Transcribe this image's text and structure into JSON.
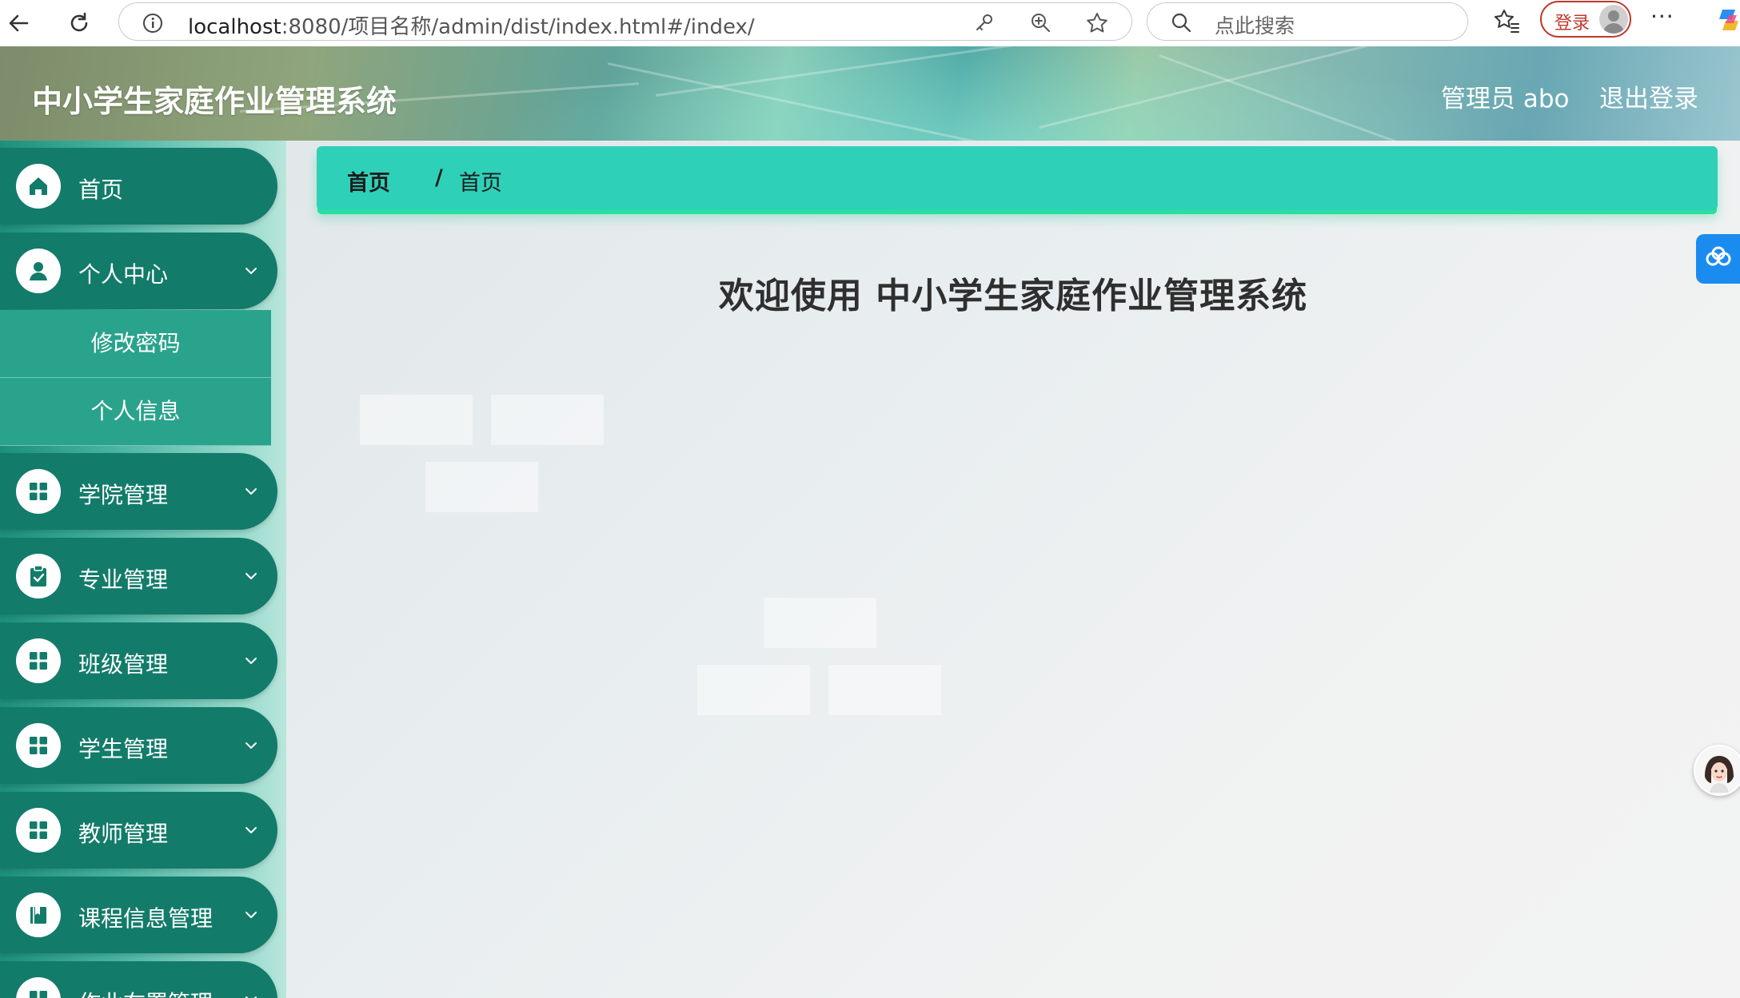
{
  "browser": {
    "url_host": "localhost",
    "url_rest": ":8080/项目名称/admin/dist/index.html#/index/",
    "search_placeholder": "点此搜索",
    "login_label": "登录",
    "more_label": "···"
  },
  "header": {
    "title": "中小学生家庭作业管理系统",
    "admin_label": "管理员 abo",
    "logout_label": "退出登录"
  },
  "sidebar": {
    "items": [
      {
        "label": "首页",
        "icon": "home-icon"
      },
      {
        "label": "个人中心",
        "icon": "user-icon",
        "expanded": true,
        "children": [
          {
            "label": "修改密码"
          },
          {
            "label": "个人信息"
          }
        ]
      },
      {
        "label": "学院管理",
        "icon": "grid-icon"
      },
      {
        "label": "专业管理",
        "icon": "clipboard-check-icon"
      },
      {
        "label": "班级管理",
        "icon": "grid-icon"
      },
      {
        "label": "学生管理",
        "icon": "grid-icon"
      },
      {
        "label": "教师管理",
        "icon": "grid-icon"
      },
      {
        "label": "课程信息管理",
        "icon": "book-icon"
      },
      {
        "label": "作业布置管理",
        "icon": "grid-icon"
      }
    ]
  },
  "breadcrumb": {
    "root": "首页",
    "separator": "/",
    "current": "首页"
  },
  "main": {
    "welcome": "欢迎使用 中小学生家庭作业管理系统"
  },
  "colors": {
    "menu_bg": "#137b6a",
    "submenu_bg": "#2aa38c",
    "breadcrumb_bg": "#2fd0b8",
    "accent_glow": "#27e0a0"
  }
}
